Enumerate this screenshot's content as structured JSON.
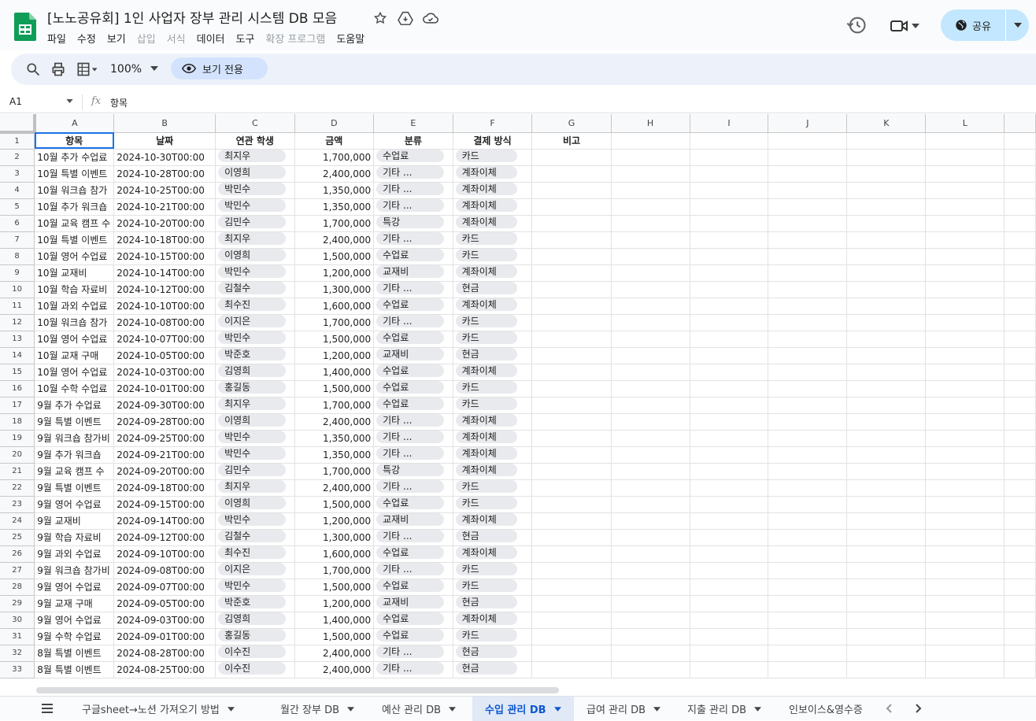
{
  "app": {
    "title": "[노노공유회] 1인 사업자 장부 관리 시스템 DB 모음",
    "menu": [
      {
        "label": "파일",
        "disabled": false
      },
      {
        "label": "수정",
        "disabled": false
      },
      {
        "label": "보기",
        "disabled": false
      },
      {
        "label": "삽입",
        "disabled": true
      },
      {
        "label": "서식",
        "disabled": true
      },
      {
        "label": "데이터",
        "disabled": false
      },
      {
        "label": "도구",
        "disabled": false
      },
      {
        "label": "확장 프로그램",
        "disabled": true
      },
      {
        "label": "도움말",
        "disabled": false
      }
    ],
    "share_label": "공유"
  },
  "toolbar": {
    "zoom": "100%",
    "view_only_label": "보기 전용"
  },
  "formula": {
    "cell_ref": "A1",
    "fx": "fx",
    "value": "항목"
  },
  "columns": [
    "A",
    "B",
    "C",
    "D",
    "E",
    "F",
    "G",
    "H",
    "I",
    "J",
    "K",
    "L"
  ],
  "header_row": [
    "항목",
    "날짜",
    "연관 학생",
    "금액",
    "분류",
    "결제 방식",
    "비고"
  ],
  "rows": [
    [
      "10월 추가 수업료",
      "2024-10-30T00:00",
      "최지우",
      "1,700,000",
      "수업료",
      "카드"
    ],
    [
      "10월 특별 이벤트",
      "2024-10-28T00:00",
      "이영희",
      "2,400,000",
      "기타 ...",
      "계좌이체"
    ],
    [
      "10월 워크숍 참가",
      "2024-10-25T00:00",
      "박민수",
      "1,350,000",
      "기타 ...",
      "계좌이체"
    ],
    [
      "10월 추가 워크숍",
      "2024-10-21T00:00",
      "박민수",
      "1,350,000",
      "기타 ...",
      "계좌이체"
    ],
    [
      "10월 교육 캠프 수",
      "2024-10-20T00:00",
      "김민수",
      "1,700,000",
      "특강",
      "계좌이체"
    ],
    [
      "10월 특별 이벤트",
      "2024-10-18T00:00",
      "최지우",
      "2,400,000",
      "기타 ...",
      "카드"
    ],
    [
      "10월 영어 수업료",
      "2024-10-15T00:00",
      "이영희",
      "1,500,000",
      "수업료",
      "카드"
    ],
    [
      "10월 교재비",
      "2024-10-14T00:00",
      "박민수",
      "1,200,000",
      "교재비",
      "계좌이체"
    ],
    [
      "10월 학습 자료비",
      "2024-10-12T00:00",
      "김철수",
      "1,300,000",
      "기타 ...",
      "현금"
    ],
    [
      "10월 과외 수업료",
      "2024-10-10T00:00",
      "최수진",
      "1,600,000",
      "수업료",
      "계좌이체"
    ],
    [
      "10월 워크숍 참가",
      "2024-10-08T00:00",
      "이지은",
      "1,700,000",
      "기타 ...",
      "카드"
    ],
    [
      "10월 영어 수업료",
      "2024-10-07T00:00",
      "박민수",
      "1,500,000",
      "수업료",
      "카드"
    ],
    [
      "10월 교재 구매",
      "2024-10-05T00:00",
      "박준호",
      "1,200,000",
      "교재비",
      "현금"
    ],
    [
      "10월 영어 수업료",
      "2024-10-03T00:00",
      "김영희",
      "1,400,000",
      "수업료",
      "계좌이체"
    ],
    [
      "10월 수학 수업료",
      "2024-10-01T00:00",
      "홍길동",
      "1,500,000",
      "수업료",
      "카드"
    ],
    [
      "9월 추가 수업료",
      "2024-09-30T00:00",
      "최지우",
      "1,700,000",
      "수업료",
      "카드"
    ],
    [
      "9월 특별 이벤트",
      "2024-09-28T00:00",
      "이영희",
      "2,400,000",
      "기타 ...",
      "계좌이체"
    ],
    [
      "9월 워크숍 참가비",
      "2024-09-25T00:00",
      "박민수",
      "1,350,000",
      "기타 ...",
      "계좌이체"
    ],
    [
      "9월 추가 워크숍",
      "2024-09-21T00:00",
      "박민수",
      "1,350,000",
      "기타 ...",
      "계좌이체"
    ],
    [
      "9월 교육 캠프 수",
      "2024-09-20T00:00",
      "김민수",
      "1,700,000",
      "특강",
      "계좌이체"
    ],
    [
      "9월 특별 이벤트",
      "2024-09-18T00:00",
      "최지우",
      "2,400,000",
      "기타 ...",
      "카드"
    ],
    [
      "9월 영어 수업료",
      "2024-09-15T00:00",
      "이영희",
      "1,500,000",
      "수업료",
      "카드"
    ],
    [
      "9월 교재비",
      "2024-09-14T00:00",
      "박민수",
      "1,200,000",
      "교재비",
      "계좌이체"
    ],
    [
      "9월 학습 자료비",
      "2024-09-12T00:00",
      "김철수",
      "1,300,000",
      "기타 ...",
      "현금"
    ],
    [
      "9월 과외 수업료",
      "2024-09-10T00:00",
      "최수진",
      "1,600,000",
      "수업료",
      "계좌이체"
    ],
    [
      "9월 워크숍 참가비",
      "2024-09-08T00:00",
      "이지은",
      "1,700,000",
      "기타 ...",
      "카드"
    ],
    [
      "9월 영어 수업료",
      "2024-09-07T00:00",
      "박민수",
      "1,500,000",
      "수업료",
      "카드"
    ],
    [
      "9월 교재 구매",
      "2024-09-05T00:00",
      "박준호",
      "1,200,000",
      "교재비",
      "현금"
    ],
    [
      "9월 영어 수업료",
      "2024-09-03T00:00",
      "김영희",
      "1,400,000",
      "수업료",
      "계좌이체"
    ],
    [
      "9월 수학 수업료",
      "2024-09-01T00:00",
      "홍길동",
      "1,500,000",
      "수업료",
      "카드"
    ],
    [
      "8월 특별 이벤트",
      "2024-08-28T00:00",
      "이수진",
      "2,400,000",
      "기타 ...",
      "현금"
    ],
    [
      "8월 특별 이벤트",
      "2024-08-25T00:00",
      "이수진",
      "2,400,000",
      "기타 ...",
      "현금"
    ]
  ],
  "sheets": [
    {
      "label": "구글sheet→노션 가져오기 방법",
      "active": false
    },
    {
      "label": "월간 장부 DB",
      "active": false
    },
    {
      "label": "예산 관리 DB",
      "active": false
    },
    {
      "label": "수입 관리 DB",
      "active": true
    },
    {
      "label": "급여 관리 DB",
      "active": false
    },
    {
      "label": "지출 관리 DB",
      "active": false
    },
    {
      "label": "인보이스&영수증",
      "active": false
    }
  ],
  "colors": {
    "accent": "#1a73e8",
    "share_bg": "#c2e7ff",
    "active_tab": "#0b57d0"
  }
}
